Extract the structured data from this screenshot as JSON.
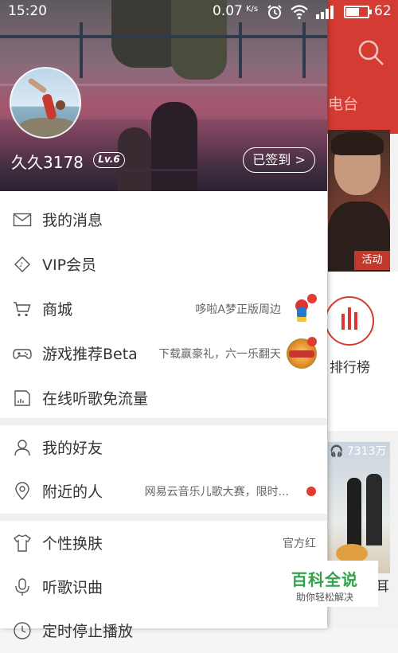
{
  "status_bar": {
    "time": "15:20",
    "speed": "0.07",
    "speed_unit": "K/s",
    "battery": "62",
    "battery_level_percent": 62
  },
  "background_app": {
    "tab_partial": "电台",
    "banner_badge": "活动",
    "rank_label": "排行榜",
    "play_count": "7313万",
    "bottom_partial": "耳"
  },
  "profile": {
    "username": "久久3178",
    "level": "Lv.6",
    "signin_label": "已签到 >"
  },
  "menu": [
    {
      "label": "我的消息",
      "right": "",
      "icon": "mail-icon"
    },
    {
      "label": "VIP会员",
      "right": "",
      "icon": "vip-diamond-icon"
    },
    {
      "label": "商城",
      "right": "哆啦A梦正版周边",
      "icon": "cart-icon"
    },
    {
      "label": "游戏推荐Beta",
      "right": "下载赢豪礼，六一乐翻天",
      "icon": "gamepad-icon"
    },
    {
      "label": "在线听歌免流量",
      "right": "",
      "icon": "sim-card-icon"
    },
    {
      "label": "我的好友",
      "right": "",
      "icon": "person-icon"
    },
    {
      "label": "附近的人",
      "right": "网易云音乐儿歌大赛，限时...",
      "icon": "location-pin-icon"
    },
    {
      "label": "个性换肤",
      "right": "官方红",
      "icon": "tshirt-icon"
    },
    {
      "label": "听歌识曲",
      "right": "",
      "icon": "microphone-icon"
    },
    {
      "label": "定时停止播放",
      "right": "",
      "icon": "clock-icon"
    }
  ],
  "watermark": {
    "title": "百科全说",
    "subtitle": "助你轻松解决"
  },
  "colors": {
    "brand_red": "#d43c33",
    "dot_red": "#e23b31",
    "watermark_green": "#2fa24a"
  }
}
